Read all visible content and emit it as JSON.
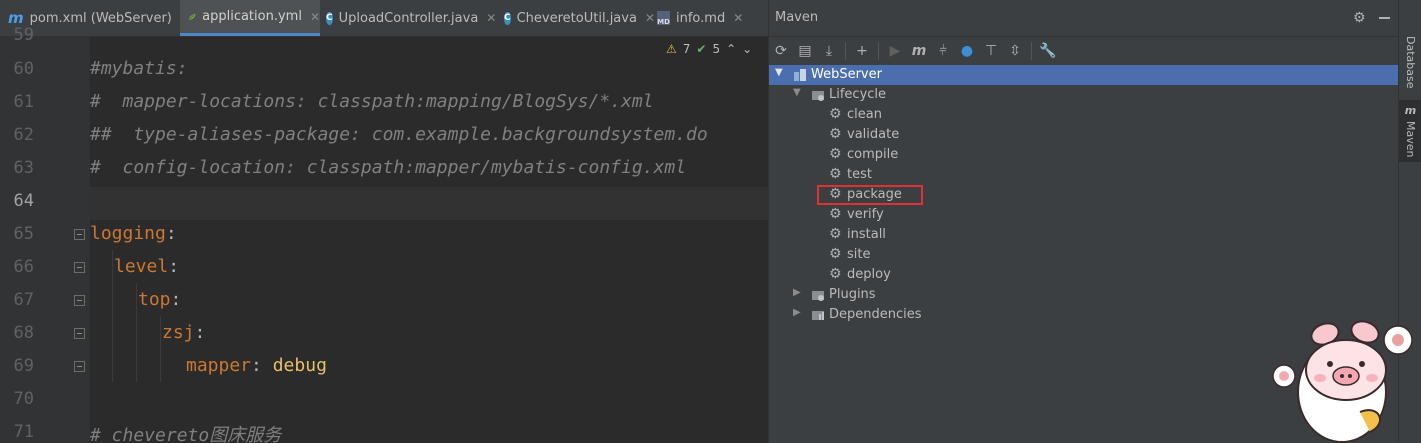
{
  "tabs": [
    {
      "label": "pom.xml (WebServer)",
      "icon": "maven-m-icon",
      "active": false
    },
    {
      "label": "application.yml",
      "icon": "yaml-leaf-icon",
      "active": true
    },
    {
      "label": "UploadController.java",
      "icon": "java-class-icon",
      "active": false
    },
    {
      "label": "CheveretoUtil.java",
      "icon": "java-class-icon",
      "active": false
    },
    {
      "label": "info.md",
      "icon": "markdown-icon",
      "active": false
    }
  ],
  "inspection": {
    "warnings": "7",
    "ok": "5"
  },
  "editor": {
    "lines": [
      {
        "no": "59"
      },
      {
        "no": "60",
        "text": "#mybatis:"
      },
      {
        "no": "61",
        "text": "#  mapper-locations: classpath:mapping/BlogSys/*.xml"
      },
      {
        "no": "62",
        "text": "##  type-aliases-package: com.example.backgroundsystem.do"
      },
      {
        "no": "63",
        "text": "#  config-location: classpath:mapper/mybatis-config.xml"
      },
      {
        "no": "64"
      },
      {
        "no": "65",
        "key": "logging",
        "punc": ":"
      },
      {
        "no": "66",
        "key": "level",
        "punc": ":"
      },
      {
        "no": "67",
        "key": "top",
        "punc": ":"
      },
      {
        "no": "68",
        "key": "zsj",
        "punc": ":"
      },
      {
        "no": "69",
        "key": "mapper",
        "punc": ": ",
        "value": "debug"
      },
      {
        "no": "70"
      },
      {
        "no": "71",
        "text": "# chevereto图床服务"
      }
    ]
  },
  "maven": {
    "title": "Maven",
    "project": "WebServer",
    "lifecycle": {
      "label": "Lifecycle",
      "goals": [
        "clean",
        "validate",
        "compile",
        "test",
        "package",
        "verify",
        "install",
        "site",
        "deploy"
      ]
    },
    "plugins": "Plugins",
    "dependencies": "Dependencies",
    "toolbar_icons": [
      "reload-icon",
      "add-folder-icon",
      "download-icon",
      "plus-icon",
      "run-icon",
      "maven-goal-icon",
      "toggle-offline-icon",
      "skip-tests-icon",
      "show-dependencies-icon",
      "collapse-all-icon",
      "settings-wrench-icon"
    ]
  },
  "side_tabs": {
    "database": "Database",
    "maven": "Maven"
  },
  "colors": {
    "accent": "#4b6eaf",
    "highlight_box": "#e0302f",
    "yaml_key": "#cc7832",
    "yaml_value": "#e8bf6a"
  }
}
